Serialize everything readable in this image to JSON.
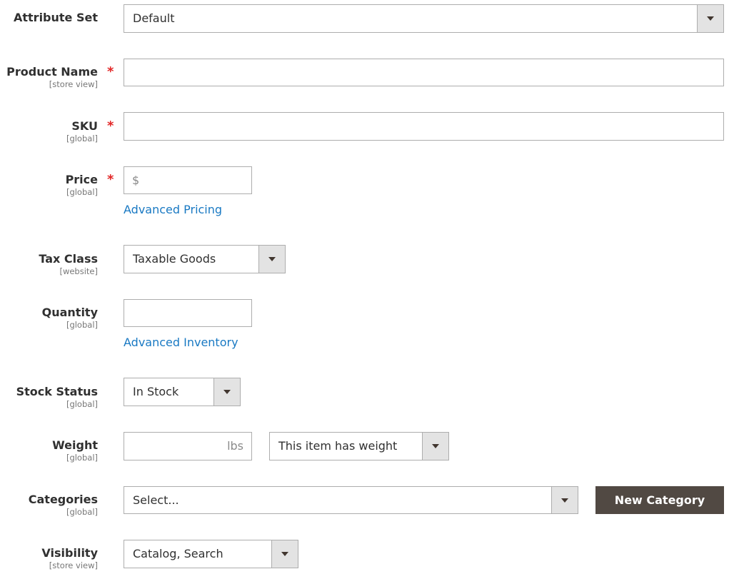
{
  "fields": {
    "attribute_set": {
      "label": "Attribute Set",
      "value": "Default"
    },
    "product_name": {
      "label": "Product Name",
      "scope": "[store view]",
      "required": "*",
      "value": ""
    },
    "sku": {
      "label": "SKU",
      "scope": "[global]",
      "required": "*",
      "value": ""
    },
    "price": {
      "label": "Price",
      "scope": "[global]",
      "required": "*",
      "currency": "$",
      "value": "",
      "link": "Advanced Pricing"
    },
    "tax_class": {
      "label": "Tax Class",
      "scope": "[website]",
      "value": "Taxable Goods"
    },
    "quantity": {
      "label": "Quantity",
      "scope": "[global]",
      "value": "",
      "link": "Advanced Inventory"
    },
    "stock_status": {
      "label": "Stock Status",
      "scope": "[global]",
      "value": "In Stock"
    },
    "weight": {
      "label": "Weight",
      "scope": "[global]",
      "unit": "lbs",
      "value": "",
      "type_value": "This item has weight"
    },
    "categories": {
      "label": "Categories",
      "scope": "[global]",
      "value": "Select...",
      "new_button": "New Category"
    },
    "visibility": {
      "label": "Visibility",
      "scope": "[store view]",
      "value": "Catalog, Search"
    }
  },
  "colors": {
    "accent_link": "#1979c3",
    "required": "#e22626",
    "button_dark": "#514943"
  },
  "icons": {
    "select_arrow": "chevron-down-icon"
  }
}
